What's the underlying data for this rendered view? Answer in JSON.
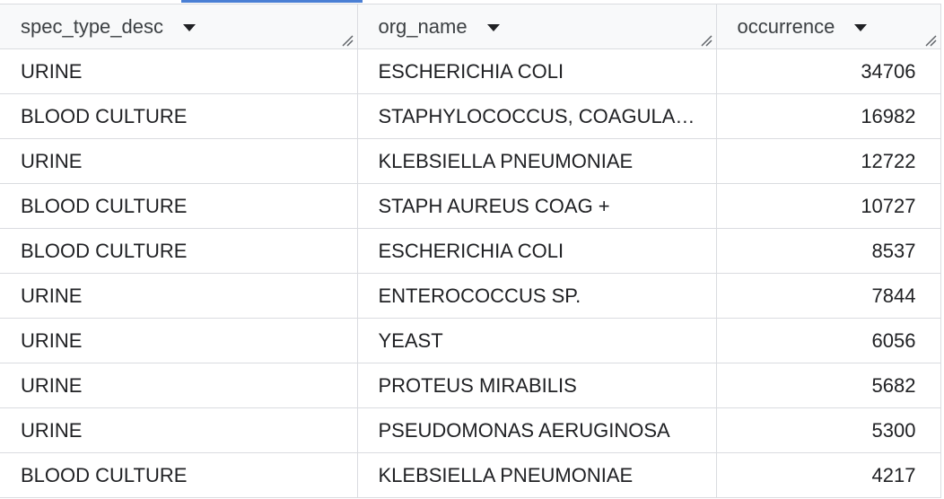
{
  "columns": [
    {
      "label": "spec_type_desc"
    },
    {
      "label": "org_name"
    },
    {
      "label": "occurrence"
    }
  ],
  "rows": [
    {
      "spec_type_desc": "URINE",
      "org_name": "ESCHERICHIA COLI",
      "occurrence": "34706"
    },
    {
      "spec_type_desc": "BLOOD CULTURE",
      "org_name": "STAPHYLOCOCCUS, COAGULA…",
      "occurrence": "16982"
    },
    {
      "spec_type_desc": "URINE",
      "org_name": "KLEBSIELLA PNEUMONIAE",
      "occurrence": "12722"
    },
    {
      "spec_type_desc": "BLOOD CULTURE",
      "org_name": "STAPH AUREUS COAG +",
      "occurrence": "10727"
    },
    {
      "spec_type_desc": "BLOOD CULTURE",
      "org_name": "ESCHERICHIA COLI",
      "occurrence": "8537"
    },
    {
      "spec_type_desc": "URINE",
      "org_name": "ENTEROCOCCUS SP.",
      "occurrence": "7844"
    },
    {
      "spec_type_desc": "URINE",
      "org_name": "YEAST",
      "occurrence": "6056"
    },
    {
      "spec_type_desc": "URINE",
      "org_name": "PROTEUS MIRABILIS",
      "occurrence": "5682"
    },
    {
      "spec_type_desc": "URINE",
      "org_name": "PSEUDOMONAS AERUGINOSA",
      "occurrence": "5300"
    },
    {
      "spec_type_desc": "BLOOD CULTURE",
      "org_name": "KLEBSIELLA PNEUMONIAE",
      "occurrence": "4217"
    }
  ],
  "icons": {
    "sort": "sort-dropdown-icon",
    "resize": "column-resize-icon"
  },
  "colors": {
    "accent": "#4a7fd4",
    "border": "#dadce0",
    "header_bg": "#f8f9fa"
  }
}
